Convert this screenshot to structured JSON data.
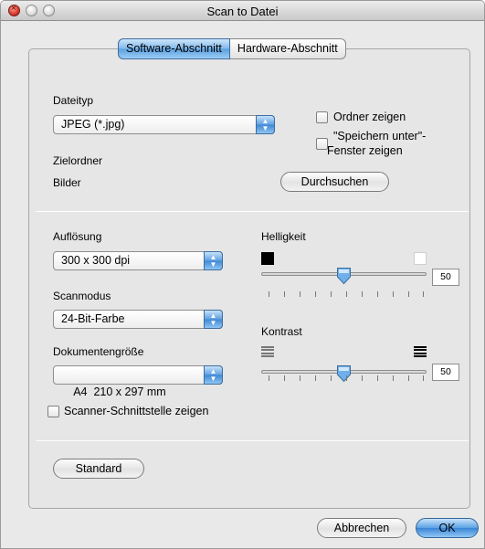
{
  "window": {
    "title": "Scan to Datei"
  },
  "tabs": [
    {
      "label": "Software-Abschnitt",
      "selected": true
    },
    {
      "label": "Hardware-Abschnitt",
      "selected": false
    }
  ],
  "file_type": {
    "label": "Dateityp",
    "value": "JPEG (*.jpg)"
  },
  "options": {
    "show_folder": {
      "label": "Ordner zeigen",
      "checked": false
    },
    "show_save_as_line1": "\"Speichern unter\"-",
    "show_save_as_line2": "Fenster zeigen",
    "show_save_as_checked": false
  },
  "target_folder": {
    "label": "Zielordner",
    "value": "Bilder",
    "browse_label": "Durchsuchen"
  },
  "resolution": {
    "label": "Auflösung",
    "value": "300 x 300 dpi"
  },
  "scan_mode": {
    "label": "Scanmodus",
    "value": "24-Bit-Farbe"
  },
  "document_size": {
    "label": "Dokumentengröße",
    "value": "A4  210 x 297 mm"
  },
  "brightness": {
    "label": "Helligkeit",
    "value": "50",
    "level": 50
  },
  "contrast": {
    "label": "Kontrast",
    "value": "50",
    "level": 50
  },
  "scanner_interface": {
    "label": "Scanner-Schnittstelle zeigen",
    "checked": false
  },
  "buttons": {
    "standard": "Standard",
    "cancel": "Abbrechen",
    "ok": "OK"
  },
  "colors": {
    "accent": "#4a90d9"
  }
}
